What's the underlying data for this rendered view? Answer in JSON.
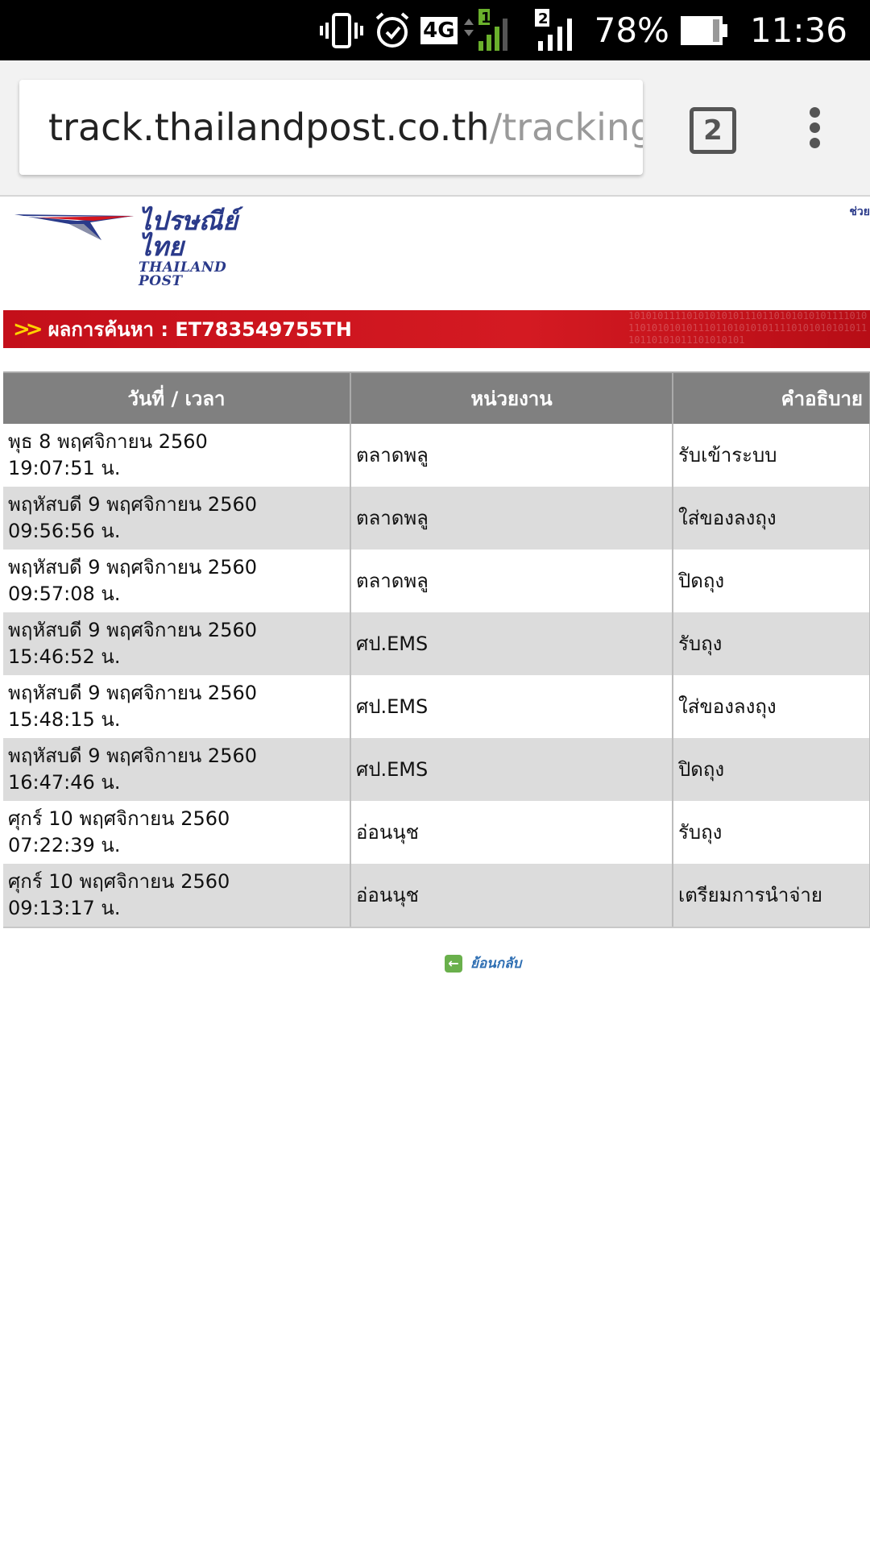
{
  "status_bar": {
    "network": "4G",
    "sim1": "1",
    "sim2": "2",
    "battery_percent": "78%",
    "time": "11:36",
    "icons": [
      "vibrate-icon",
      "alarm-icon",
      "signal-icon",
      "battery-icon"
    ]
  },
  "browser": {
    "url_host": "track.thailandpost.co.th",
    "url_path": "/tracking/",
    "tab_count": "2"
  },
  "header": {
    "logo_thai": "ไปรษณีย์ไทย",
    "logo_english": "THAILAND POST",
    "help_link": "ช่วย"
  },
  "result": {
    "label": "ผลการค้นหา : ET783549755TH"
  },
  "table": {
    "headers": [
      "วันที่ / เวลา",
      "หน่วยงาน",
      "คำอธิบาย"
    ],
    "rows": [
      {
        "date": "พุธ 8 พฤศจิกายน 2560",
        "time": "19:07:51 น.",
        "unit": "ตลาดพลู",
        "description": "รับเข้าระบบ"
      },
      {
        "date": "พฤหัสบดี 9 พฤศจิกายน 2560",
        "time": "09:56:56 น.",
        "unit": "ตลาดพลู",
        "description": "ใส่ของลงถุง"
      },
      {
        "date": "พฤหัสบดี 9 พฤศจิกายน 2560",
        "time": "09:57:08 น.",
        "unit": "ตลาดพลู",
        "description": "ปิดถุง"
      },
      {
        "date": "พฤหัสบดี 9 พฤศจิกายน 2560",
        "time": "15:46:52 น.",
        "unit": "ศป.EMS",
        "description": "รับถุง"
      },
      {
        "date": "พฤหัสบดี 9 พฤศจิกายน 2560",
        "time": "15:48:15 น.",
        "unit": "ศป.EMS",
        "description": "ใส่ของลงถุง"
      },
      {
        "date": "พฤหัสบดี 9 พฤศจิกายน 2560",
        "time": "16:47:46 น.",
        "unit": "ศป.EMS",
        "description": "ปิดถุง"
      },
      {
        "date": "ศุกร์ 10 พฤศจิกายน 2560",
        "time": "07:22:39 น.",
        "unit": "อ่อนนุช",
        "description": "รับถุง"
      },
      {
        "date": "ศุกร์ 10 พฤศจิกายน 2560",
        "time": "09:13:17 น.",
        "unit": "อ่อนนุช",
        "description": "เตรียมการนำจ่าย"
      }
    ]
  },
  "back": {
    "label": "ย้อนกลับ",
    "icon": "back-arrow-icon"
  },
  "colors": {
    "banner_red": "#c40f1a",
    "header_gray": "#808080",
    "row_alt": "#dcdcdc",
    "logo_blue": "#2a3a8a"
  }
}
